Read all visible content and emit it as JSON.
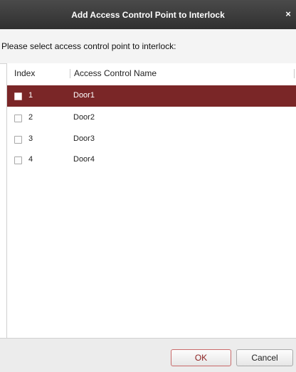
{
  "dialog": {
    "title": "Add Access Control Point to Interlock",
    "close_glyph": "×"
  },
  "prompt": {
    "text": "Please select access control point to interlock:"
  },
  "table": {
    "columns": [
      "Index",
      "Access Control Name"
    ],
    "rows": [
      {
        "index": "1",
        "name": "Door1",
        "selected": true
      },
      {
        "index": "2",
        "name": "Door2",
        "selected": false
      },
      {
        "index": "3",
        "name": "Door3",
        "selected": false
      },
      {
        "index": "4",
        "name": "Door4",
        "selected": false
      }
    ]
  },
  "buttons": {
    "ok": "OK",
    "cancel": "Cancel"
  },
  "colors": {
    "title_bar": "#3a3a3a",
    "selected_row": "#7a2627",
    "ok_border": "#c96a6a"
  }
}
